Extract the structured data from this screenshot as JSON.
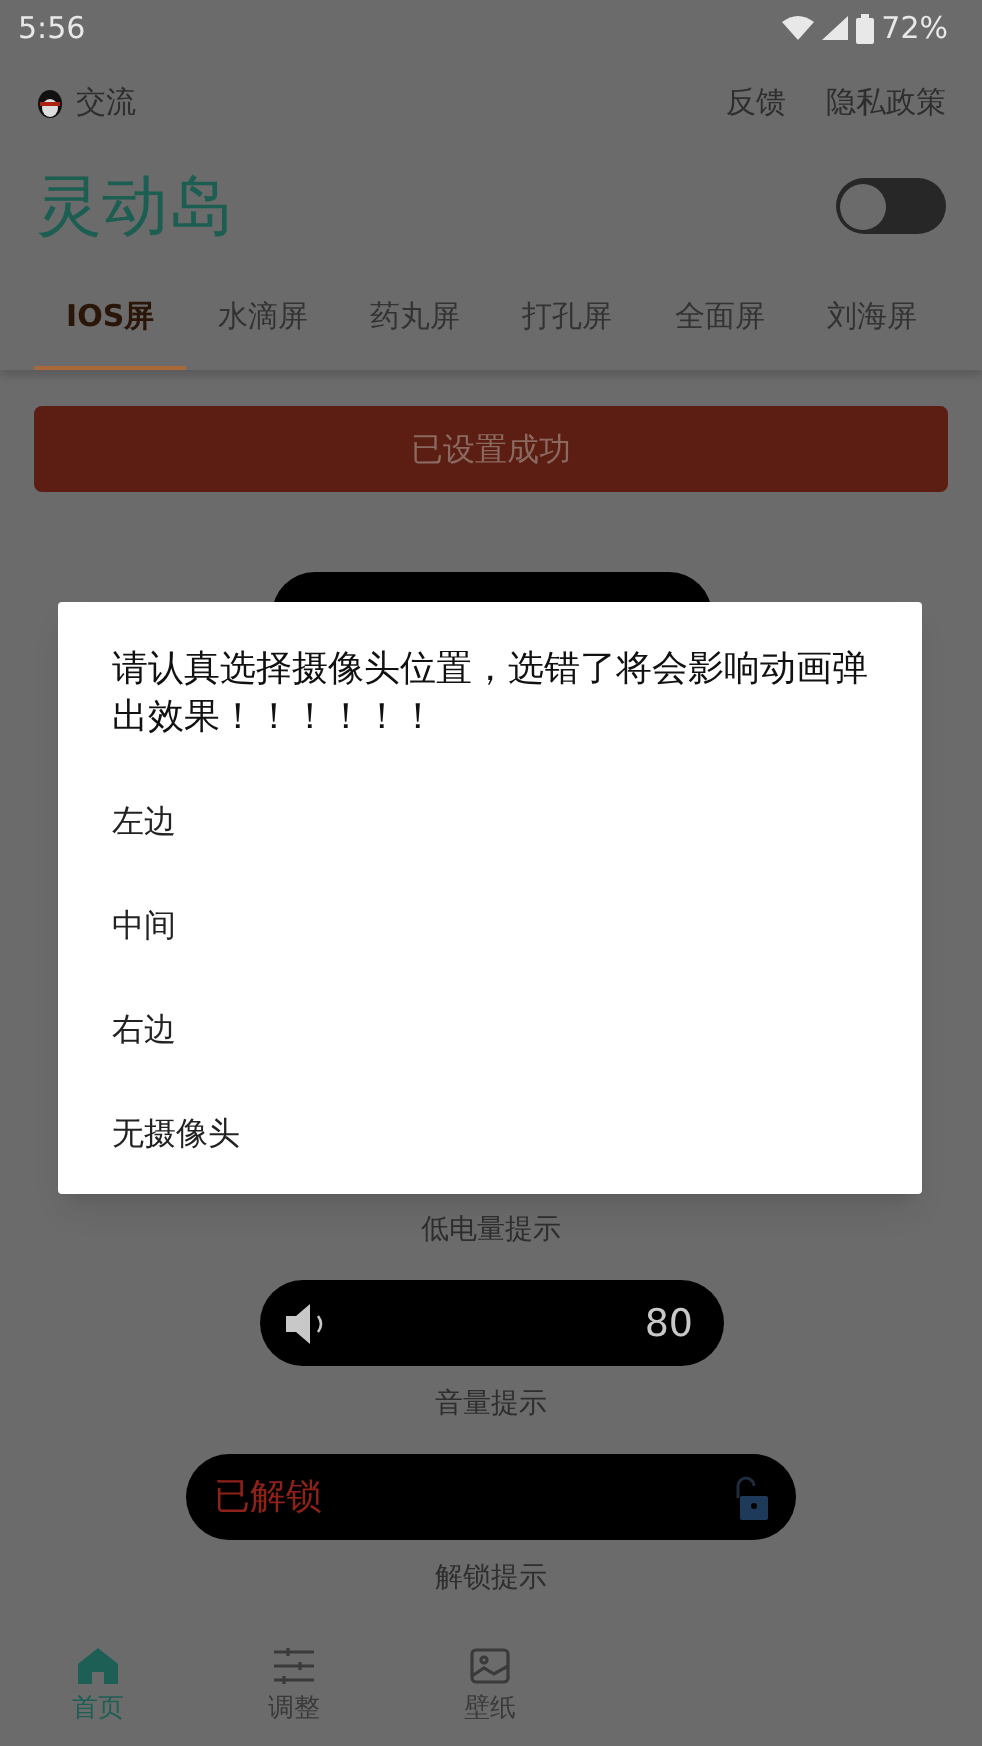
{
  "status_bar": {
    "time": "5:56",
    "battery": "72%"
  },
  "top_links": {
    "left": "交流",
    "right": [
      "反馈",
      "隐私政策"
    ]
  },
  "header": {
    "title": "灵动岛",
    "toggle": {
      "on": false
    }
  },
  "tabs": [
    {
      "label": "IOS屏",
      "selected": true
    },
    {
      "label": "水滴屏",
      "selected": false
    },
    {
      "label": "药丸屏",
      "selected": false
    },
    {
      "label": "打孔屏",
      "selected": false
    },
    {
      "label": "全面屏",
      "selected": false
    },
    {
      "label": "刘海屏",
      "selected": false
    }
  ],
  "status_button": "已设置成功",
  "previews": [
    {
      "kind": "hidden",
      "label": "低电量提示"
    },
    {
      "kind": "volume",
      "value": "80",
      "label": "音量提示"
    },
    {
      "kind": "unlock",
      "text": "已解锁",
      "label": "解锁提示"
    }
  ],
  "dialog": {
    "message": "请认真选择摄像头位置，选错了将会影响动画弹出效果！！！！！！",
    "options": [
      "左边",
      "中间",
      "右边",
      "无摄像头"
    ]
  },
  "bottom_nav": [
    {
      "label": "首页",
      "kind": "home",
      "selected": true
    },
    {
      "label": "调整",
      "kind": "sliders",
      "selected": false
    },
    {
      "label": "壁纸",
      "kind": "image",
      "selected": false
    }
  ]
}
